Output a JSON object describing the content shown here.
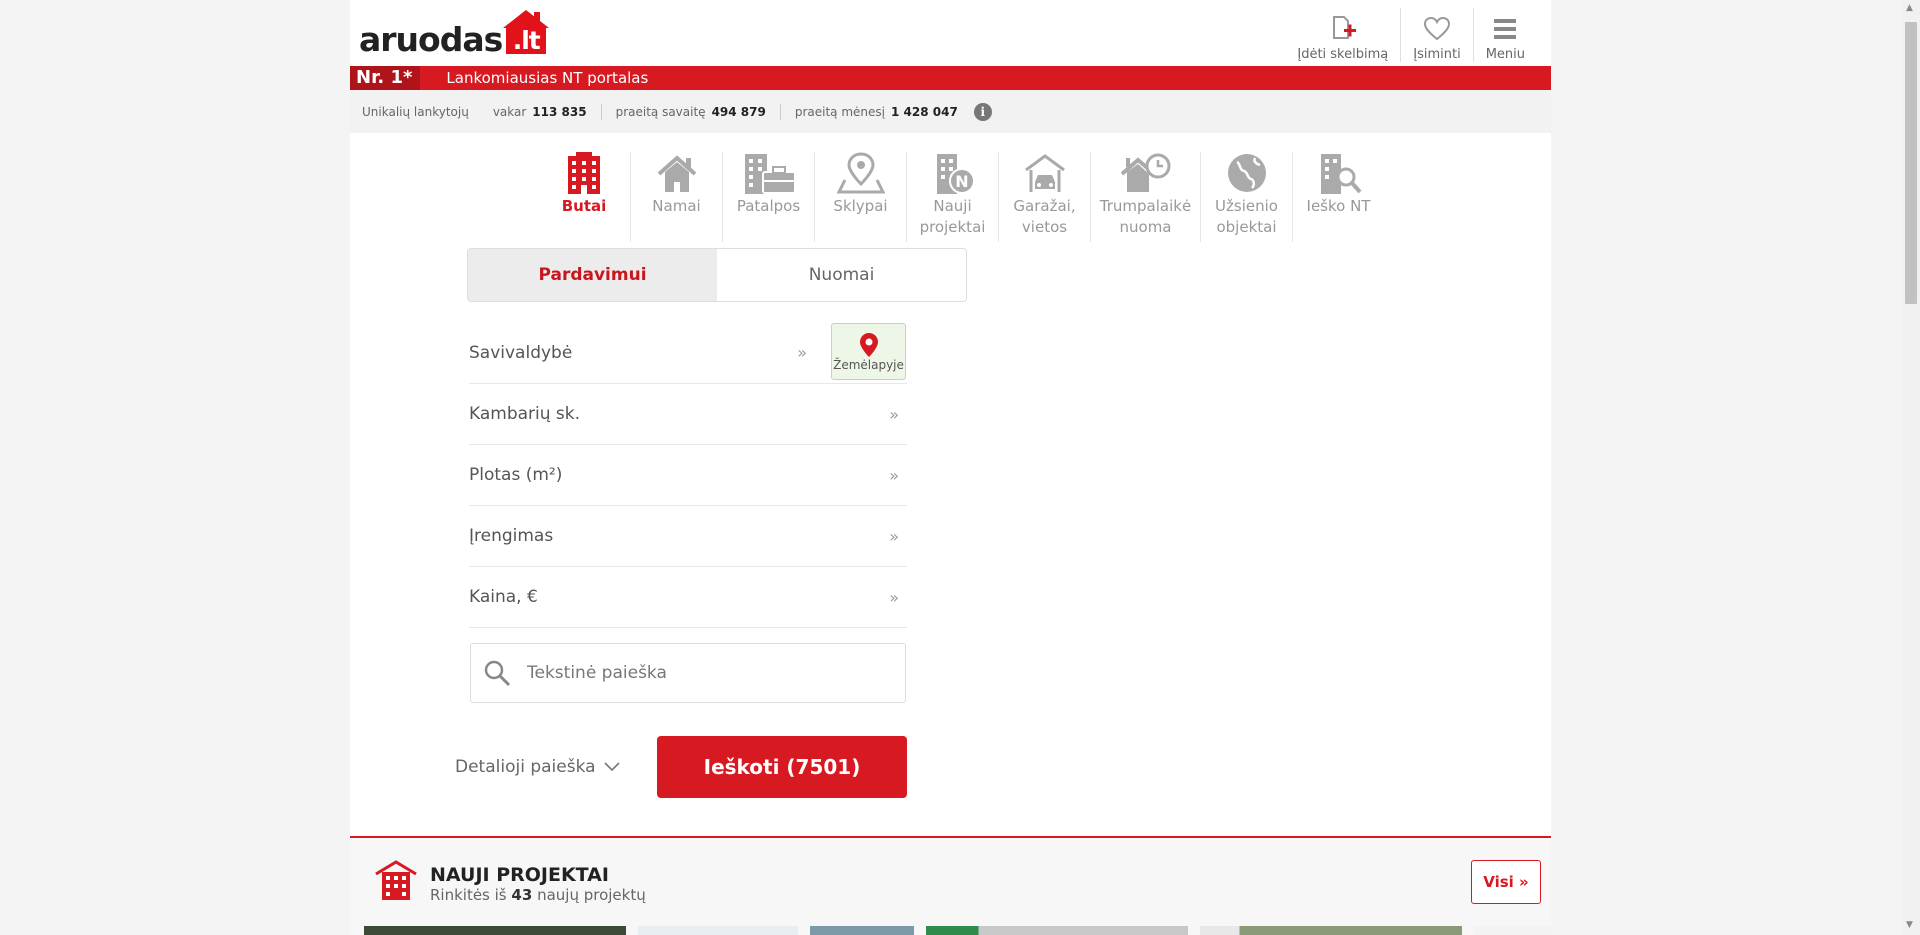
{
  "header": {
    "logo_text": "aruodas",
    "logo_suffix": ".lt",
    "actions": [
      {
        "label": "Įdėti skelbimą",
        "icon": "add-listing-icon"
      },
      {
        "label": "Įsiminti",
        "icon": "heart-icon"
      },
      {
        "label": "Meniu",
        "icon": "menu-icon"
      }
    ]
  },
  "banner": {
    "badge": "Nr. 1*",
    "text": "Lankomiausias NT portalas"
  },
  "stats": {
    "label": "Unikalių lankytojų",
    "items": [
      {
        "label": "vakar",
        "value": "113 835"
      },
      {
        "label": "praeitą savaitę",
        "value": "494 879"
      },
      {
        "label": "praeitą mėnesį",
        "value": "1 428 047"
      }
    ],
    "info": "i"
  },
  "categories": [
    {
      "label": "Butai",
      "icon": "apartments-icon",
      "active": true
    },
    {
      "label": "Namai",
      "icon": "house-icon"
    },
    {
      "label": "Patalpos",
      "icon": "premises-icon"
    },
    {
      "label": "Sklypai",
      "icon": "land-plot-icon"
    },
    {
      "label": "Nauji\nprojektai",
      "icon": "new-projects-icon"
    },
    {
      "label": "Garažai,\nvietos",
      "icon": "garage-icon"
    },
    {
      "label": "Trumpalaikė\nnuoma",
      "icon": "short-term-rent-icon"
    },
    {
      "label": "Užsienio\nobjektai",
      "icon": "globe-icon"
    },
    {
      "label": "Ieško NT",
      "icon": "search-property-icon"
    }
  ],
  "tabs": [
    {
      "label": "Pardavimui",
      "active": true
    },
    {
      "label": "Nuomai"
    }
  ],
  "filters": [
    {
      "label": "Savivaldybė"
    },
    {
      "label": "Kambarių sk."
    },
    {
      "label": "Plotas (m²)"
    },
    {
      "label": "Įrengimas"
    },
    {
      "label": "Kaina, €"
    }
  ],
  "filter_arrow": "»",
  "map_button": {
    "label": "Žemėlapyje"
  },
  "text_search": {
    "placeholder": "Tekstinė paieška"
  },
  "detail_search": {
    "label": "Detalioji paieška"
  },
  "search_button": {
    "label": "Ieškoti (7501)"
  },
  "new_projects": {
    "title": "NAUJI PROJEKTAI",
    "subtitle_prefix": "Rinkitės iš",
    "count": "43",
    "subtitle_suffix": "naujų projektų",
    "all_label": "Visi »"
  },
  "colors": {
    "brand_red": "#d71921",
    "muted_icon": "#999999"
  }
}
